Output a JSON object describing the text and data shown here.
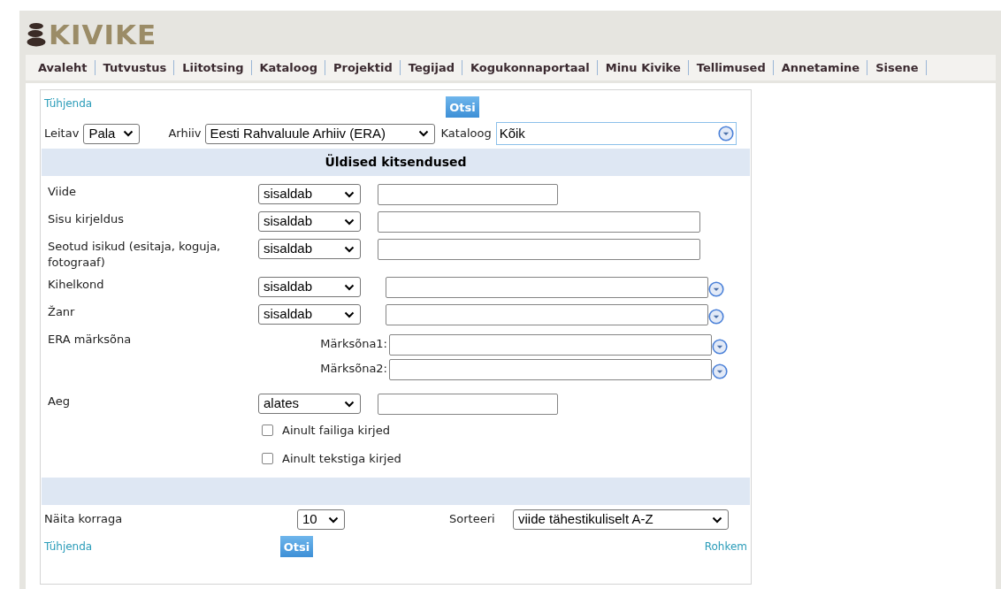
{
  "logo": {
    "text": "KIVIKE"
  },
  "nav": [
    "Avaleht",
    "Tutvustus",
    "Liitotsing",
    "Kataloog",
    "Projektid",
    "Tegijad",
    "Kogukonnaportaal",
    "Minu Kivike",
    "Tellimused",
    "Annetamine",
    "Sisene"
  ],
  "form": {
    "clear_link": "Tühjenda",
    "search_button": "Otsi",
    "leitav": {
      "label": "Leitav",
      "value": "Pala"
    },
    "arhiiv": {
      "label": "Arhiiv",
      "value": "Eesti Rahvaluule Arhiiv (ERA)"
    },
    "kataloog": {
      "label": "Kataloog",
      "value": "Kõik"
    },
    "section_title": "Üldised kitsendused",
    "fields": [
      {
        "kind": "short",
        "label": "Viide",
        "operator": "sisaldab"
      },
      {
        "kind": "long",
        "label": "Sisu kirjeldus",
        "operator": "sisaldab"
      },
      {
        "kind": "long",
        "label": "Seotud isikud (esitaja, koguja, fotograaf)",
        "operator": "sisaldab"
      },
      {
        "kind": "picker",
        "label": "Kihelkond",
        "operator": "sisaldab"
      },
      {
        "kind": "picker",
        "label": "Žanr",
        "operator": "sisaldab"
      },
      {
        "kind": "keywords",
        "label": "ERA märksõna",
        "keywords": [
          "Märksõna1:",
          "Märksõna2:"
        ]
      },
      {
        "kind": "short",
        "label": "Aeg",
        "operator": "alates"
      }
    ],
    "checkboxes": [
      {
        "label": "Ainult failiga kirjed",
        "checked": false
      },
      {
        "label": "Ainult tekstiga kirjed",
        "checked": false
      }
    ],
    "per_page": {
      "label": "Näita korraga",
      "value": "10"
    },
    "sort": {
      "label": "Sorteeri",
      "value": "viide tähestikuliselt A-Z"
    },
    "bottom_clear_link": "Tühjenda",
    "bottom_search_button": "Otsi",
    "more_link": "Rohkem"
  }
}
